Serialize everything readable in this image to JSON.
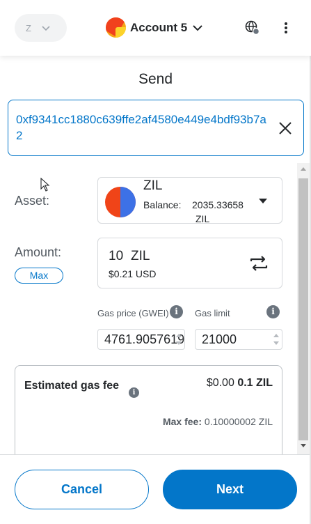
{
  "header": {
    "network_label": "Z",
    "account_name": "Account 5",
    "icons": [
      "chevron-down-icon",
      "connected-sites-icon",
      "more-options-icon"
    ]
  },
  "page": {
    "title": "Send"
  },
  "recipient": {
    "address": "0xf9341cc1880c639ffe2af4580e449e4bdf93b7a2"
  },
  "asset": {
    "label": "Asset:",
    "symbol": "ZIL",
    "balance_label": "Balance:",
    "balance_value": "2035.33658",
    "balance_unit": "ZIL"
  },
  "amount": {
    "label": "Amount:",
    "max_label": "Max",
    "value": "10",
    "unit": "ZIL",
    "fiat": "$0.21 USD"
  },
  "gas": {
    "price_label": "Gas price (GWEI)",
    "price_value": "4761.9057619",
    "limit_label": "Gas limit",
    "limit_value": "21000"
  },
  "fee": {
    "title": "Estimated gas fee",
    "fiat": "$0.00",
    "native": "0.1 ZIL",
    "max_label": "Max fee:",
    "max_value": "0.10000002 ZIL"
  },
  "footer": {
    "cancel_label": "Cancel",
    "next_label": "Next"
  },
  "colors": {
    "accent": "#0376c9",
    "text": "#24272a",
    "muted": "#535a61",
    "border": "#d6d9dc"
  }
}
